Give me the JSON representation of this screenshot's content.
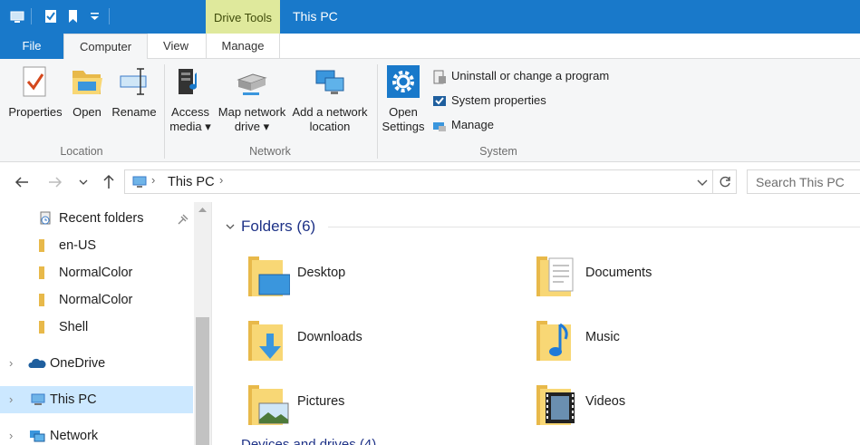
{
  "titlebar": {
    "context_tab": "Drive Tools",
    "window_title": "This PC",
    "background": "#1979ca"
  },
  "tabs": {
    "file": "File",
    "computer": "Computer",
    "view": "View",
    "manage": "Manage"
  },
  "ribbon": {
    "location": {
      "label": "Location",
      "properties": "Properties",
      "open": "Open",
      "rename": "Rename"
    },
    "network": {
      "label": "Network",
      "access_media_1": "Access",
      "access_media_2": "media ▾",
      "map_drive_1": "Map network",
      "map_drive_2": "drive ▾",
      "add_location_1": "Add a network",
      "add_location_2": "location"
    },
    "system": {
      "label": "System",
      "open_settings_1": "Open",
      "open_settings_2": "Settings",
      "uninstall": "Uninstall or change a program",
      "system_properties": "System properties",
      "manage": "Manage"
    }
  },
  "address": {
    "crumb": "This PC",
    "search_placeholder": "Search This PC"
  },
  "nav": {
    "items": [
      {
        "label": "Recent folders",
        "icon": "recent-folders-icon"
      },
      {
        "label": "en-US",
        "icon": "folder-icon"
      },
      {
        "label": "NormalColor",
        "icon": "folder-icon"
      },
      {
        "label": "NormalColor",
        "icon": "folder-icon"
      },
      {
        "label": "Shell",
        "icon": "folder-icon"
      },
      {
        "label": "OneDrive",
        "icon": "onedrive-icon"
      },
      {
        "label": "This PC",
        "icon": "this-pc-icon"
      },
      {
        "label": "Network",
        "icon": "network-icon"
      }
    ]
  },
  "content": {
    "folders_header": "Folders (6)",
    "folders": [
      {
        "label": "Desktop",
        "icon": "desktop-folder-icon"
      },
      {
        "label": "Documents",
        "icon": "documents-folder-icon"
      },
      {
        "label": "Downloads",
        "icon": "downloads-folder-icon"
      },
      {
        "label": "Music",
        "icon": "music-folder-icon"
      },
      {
        "label": "Pictures",
        "icon": "pictures-folder-icon"
      },
      {
        "label": "Videos",
        "icon": "videos-folder-icon"
      }
    ],
    "next_header": "Devices and drives (4)"
  },
  "colors": {
    "accent": "#1979ca",
    "context_tab": "#dfe99c",
    "selection": "#cce8ff",
    "header_text": "#1e3287"
  }
}
